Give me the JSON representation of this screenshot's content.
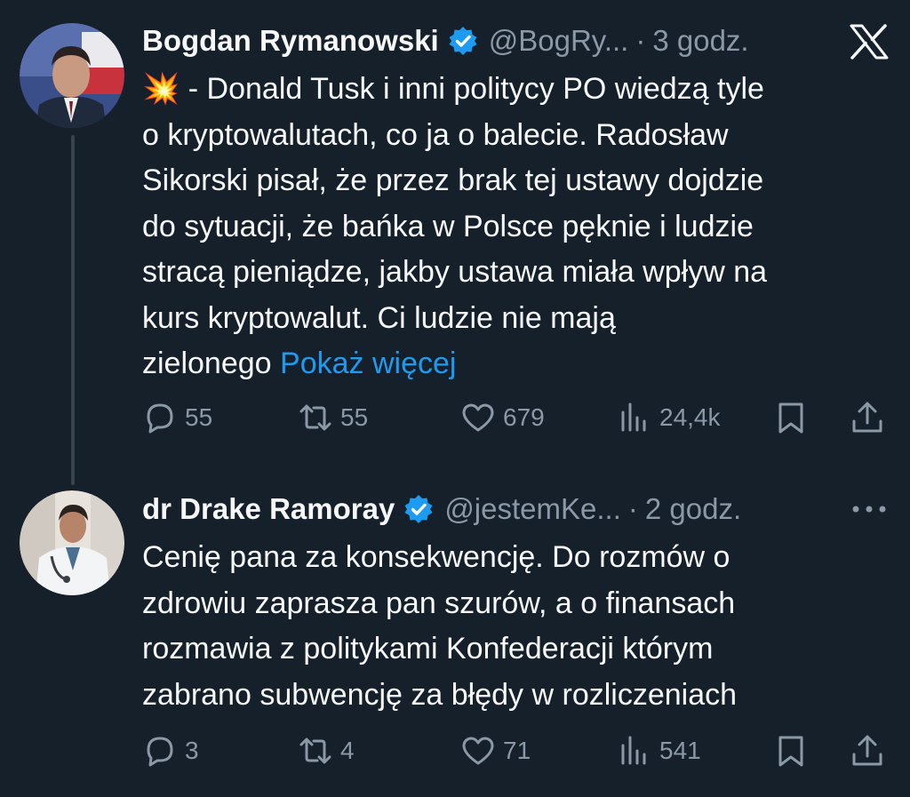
{
  "tweets": [
    {
      "author_name": "Bogdan Rymanowski",
      "handle": "@BogRy...",
      "separator": "·",
      "time": "3 godz.",
      "emoji": "💥",
      "lines": [
        " - Donald Tusk i inni politycy PO wiedzą tyle",
        "o kryptowalutach, co ja o balecie. Radosław",
        "Sikorski pisał, że przez brak tej ustawy dojdzie",
        "do sytuacji, że bańka w Polsce pęknie i ludzie",
        "stracą pieniądze, jakby ustawa miała wpływ na",
        "kurs kryptowalut. Ci ludzie nie mają",
        "zielonego "
      ],
      "show_more": "Pokaż więcej",
      "replies": "55",
      "retweets": "55",
      "likes": "679",
      "views": "24,4k"
    },
    {
      "author_name": "dr Drake Ramoray",
      "handle": "@jestemKe...",
      "separator": "·",
      "time": "2 godz.",
      "lines": [
        "Cenię pana za konsekwencję. Do rozmów o",
        "zdrowiu zaprasza pan szurów, a o finansach",
        "rozmawia z politykami Konfederacji którym",
        "zabrano subwencję za błędy w rozliczeniach"
      ],
      "replies": "3",
      "retweets": "4",
      "likes": "71",
      "views": "541"
    }
  ],
  "colors": {
    "background": "#15202b",
    "text": "#f7f9f9",
    "secondary": "#8b98a5",
    "link": "#1d9bf0",
    "verified": "#1d9bf0",
    "thread_line": "#38444d"
  },
  "icons": {
    "close": "x-logo-icon",
    "more": "more-dots-icon",
    "verified": "verified-badge-icon",
    "reply": "reply-icon",
    "retweet": "retweet-icon",
    "like": "heart-icon",
    "views": "views-bar-icon",
    "bookmark": "bookmark-icon",
    "share": "share-icon"
  }
}
